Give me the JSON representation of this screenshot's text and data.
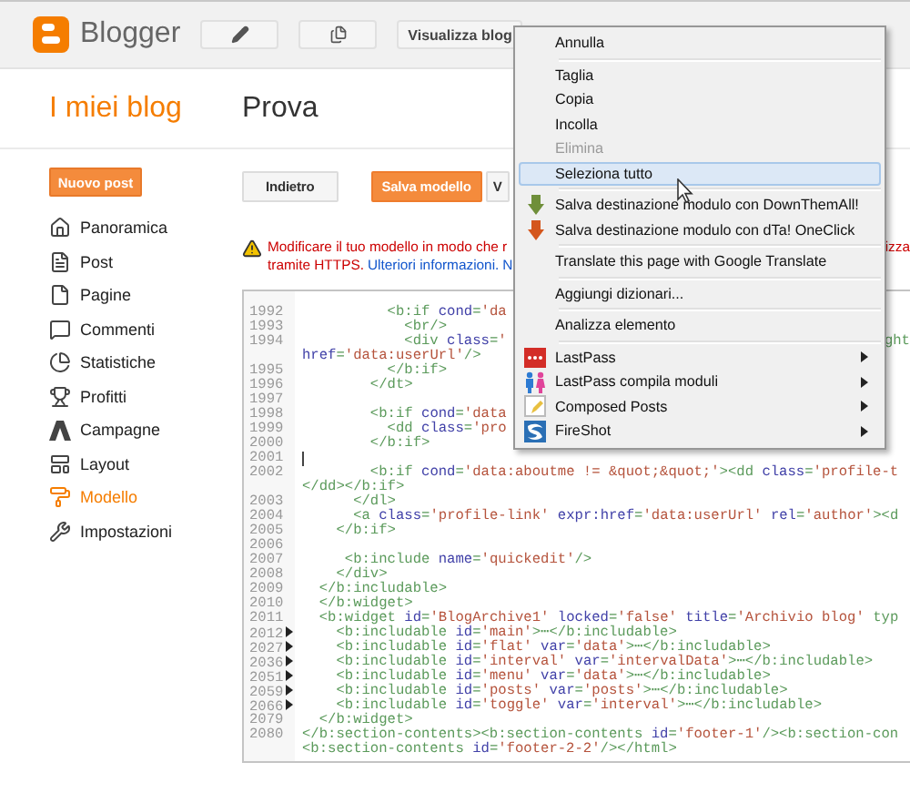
{
  "header": {
    "brand": "Blogger",
    "actions": [
      {
        "kind": "pencil"
      },
      {
        "kind": "pages"
      },
      {
        "kind": "text",
        "label": "Visualizza blog"
      }
    ]
  },
  "titles": {
    "section": "I miei blog",
    "blog": "Prova"
  },
  "sidebar": {
    "new_post": "Nuovo post",
    "items": [
      {
        "label": "Panoramica",
        "selected": false
      },
      {
        "label": "Post",
        "selected": false
      },
      {
        "label": "Pagine",
        "selected": false
      },
      {
        "label": "Commenti",
        "selected": false
      },
      {
        "label": "Statistiche",
        "selected": false
      },
      {
        "label": "Profitti",
        "selected": false
      },
      {
        "label": "Campagne",
        "selected": false
      },
      {
        "label": "Layout",
        "selected": false
      },
      {
        "label": "Modello",
        "selected": true
      },
      {
        "label": "Impostazioni",
        "selected": false
      }
    ]
  },
  "toolbar": [
    {
      "label": "Indietro",
      "kind": "default"
    },
    {
      "label": "Salva modello",
      "kind": "primary"
    },
    {
      "label": "V",
      "kind": "default"
    }
  ],
  "warning": {
    "line1": "Modificare il tuo modello in modo che r",
    "line1_tail": "izza",
    "line2": "tramite HTTPS.",
    "link": "Ulteriori informazioni.",
    "line2_end": "N"
  },
  "editor": {
    "lines": [
      {
        "number": "1992",
        "text": "          <b:if cond='da",
        "folded": false
      },
      {
        "number": "1993",
        "text": "            <br/>",
        "folded": false
      },
      {
        "number": "1994",
        "text": "            <div class='",
        "tail": "ght",
        "folded": false
      },
      {
        "text": "href='data:userUrl'/>",
        "folded": false
      },
      {
        "number": "1995",
        "text": "          </b:if>",
        "folded": false
      },
      {
        "number": "1996",
        "text": "        </dt>",
        "folded": false
      },
      {
        "number": "1997",
        "folded": false
      },
      {
        "number": "1998",
        "text": "        <b:if cond='data",
        "folded": false
      },
      {
        "number": "1999",
        "text": "          <dd class='pro",
        "folded": false
      },
      {
        "number": "2000",
        "text": "        </b:if>",
        "folded": false
      },
      {
        "number": "2001",
        "cursor": true,
        "folded": false
      },
      {
        "number": "2002",
        "text": "        <b:if cond='data:aboutme != &quot;&quot;'><dd class='profile-t",
        "folded": false
      },
      {
        "text": "</dd></b:if>",
        "folded": false
      },
      {
        "number": "2003",
        "text": "      </dl>",
        "folded": false
      },
      {
        "number": "2004",
        "text": "      <a class='profile-link' expr:href='data:userUrl' rel='author'><d",
        "folded": false
      },
      {
        "number": "2005",
        "text": "    </b:if>",
        "folded": false
      },
      {
        "number": "2006",
        "folded": false
      },
      {
        "number": "2007",
        "text": "     <b:include name='quickedit'/>",
        "folded": false
      },
      {
        "number": "2008",
        "text": "    </div>",
        "folded": false
      },
      {
        "number": "2009",
        "text": "  </b:includable>",
        "folded": false
      },
      {
        "number": "2010",
        "text": "  </b:widget>",
        "folded": false
      },
      {
        "number": "2011",
        "text": "  <b:widget id='BlogArchive1' locked='false' title='Archivio blog' typ",
        "folded": false
      },
      {
        "number": "2012",
        "text": "    <b:includable id='main'>⋯</b:includable>",
        "folded": true
      },
      {
        "number": "2027",
        "text": "    <b:includable id='flat' var='data'>⋯</b:includable>",
        "folded": true
      },
      {
        "number": "2036",
        "text": "    <b:includable id='interval' var='intervalData'>⋯</b:includable>",
        "folded": true
      },
      {
        "number": "2051",
        "text": "    <b:includable id='menu' var='data'>⋯</b:includable>",
        "folded": true
      },
      {
        "number": "2059",
        "text": "    <b:includable id='posts' var='posts'>⋯</b:includable>",
        "folded": true
      },
      {
        "number": "2066",
        "text": "    <b:includable id='toggle' var='interval'>⋯</b:includable>",
        "folded": true
      },
      {
        "number": "2079",
        "text": "  </b:widget>",
        "folded": false
      },
      {
        "number": "2080",
        "text": "</b:section-contents><b:section-contents id='footer-1'/><b:section-con",
        "folded": false
      },
      {
        "text": "<b:section-contents id='footer-2-2'/></html>",
        "folded": false
      }
    ]
  },
  "context_menu": {
    "groups": [
      [
        {
          "label": "Annulla",
          "disabled": false,
          "highlighted": false,
          "submenu": false
        }
      ],
      [
        {
          "label": "Taglia",
          "disabled": false,
          "highlighted": false,
          "submenu": false
        },
        {
          "label": "Copia",
          "disabled": false,
          "highlighted": false,
          "submenu": false
        },
        {
          "label": "Incolla",
          "disabled": false,
          "highlighted": false,
          "submenu": false
        },
        {
          "label": "Elimina",
          "disabled": true,
          "highlighted": false,
          "submenu": false
        },
        {
          "label": "Seleziona tutto",
          "disabled": false,
          "highlighted": true,
          "submenu": false
        }
      ],
      [
        {
          "label": "Salva destinazione modulo con DownThemAll!",
          "disabled": false,
          "highlighted": false,
          "submenu": false
        },
        {
          "label": "Salva destinazione modulo con dTa! OneClick",
          "disabled": false,
          "highlighted": false,
          "submenu": false
        }
      ],
      [
        {
          "label": "Translate this page with Google Translate",
          "disabled": false,
          "highlighted": false,
          "submenu": false
        }
      ],
      [
        {
          "label": "Aggiungi dizionari...",
          "disabled": false,
          "highlighted": false,
          "submenu": false
        }
      ],
      [
        {
          "label": "Analizza elemento",
          "disabled": false,
          "highlighted": false,
          "submenu": false
        }
      ],
      [
        {
          "label": "LastPass",
          "disabled": false,
          "highlighted": false,
          "submenu": true
        },
        {
          "label": "LastPass compila moduli",
          "disabled": false,
          "highlighted": false,
          "submenu": true
        },
        {
          "label": "Composed Posts",
          "disabled": false,
          "highlighted": false,
          "submenu": true
        },
        {
          "label": "FireShot",
          "disabled": false,
          "highlighted": false,
          "submenu": true
        }
      ]
    ]
  }
}
